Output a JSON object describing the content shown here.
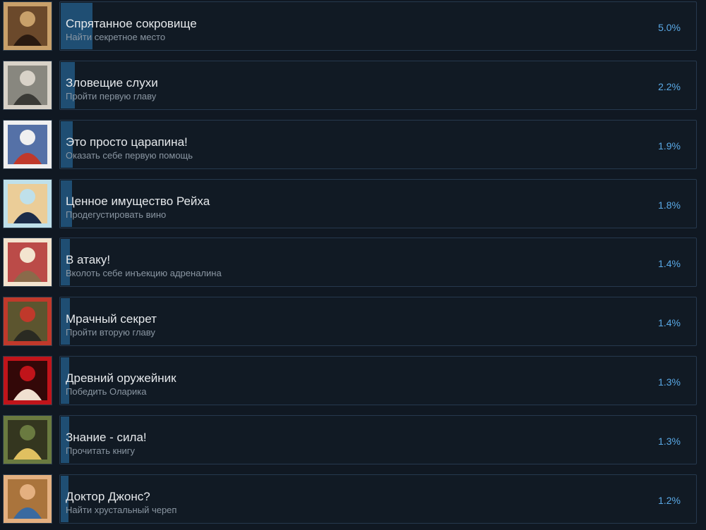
{
  "achievements": [
    {
      "title": "Спрятанное сокровище",
      "desc": "Найти секретное место",
      "percent_label": "5.0%",
      "percent": 5.0,
      "icon": "treasure-painting-icon",
      "colors": [
        "#c8a06a",
        "#5a3a20",
        "#2a1a10"
      ]
    },
    {
      "title": "Зловещие слухи",
      "desc": "Пройти первую главу",
      "percent_label": "2.2%",
      "percent": 2.2,
      "icon": "helmet-soldier-icon",
      "colors": [
        "#d8d2c8",
        "#7a7a72",
        "#3a3a36"
      ]
    },
    {
      "title": "Это просто царапина!",
      "desc": "Оказать себе первую помощь",
      "percent_label": "1.9%",
      "percent": 1.9,
      "icon": "first-aid-poster-icon",
      "colors": [
        "#f0f0f0",
        "#3a5a9a",
        "#c0392b"
      ]
    },
    {
      "title": "Ценное имущество Рейха",
      "desc": "Продегустировать вино",
      "percent_label": "1.8%",
      "percent": 1.8,
      "icon": "blindfolded-man-icon",
      "colors": [
        "#bfe0ea",
        "#f2c98a",
        "#1c2c48"
      ]
    },
    {
      "title": "В атаку!",
      "desc": "Вколоть себе инъекцию адреналина",
      "percent_label": "1.4%",
      "percent": 1.4,
      "icon": "pinup-soldier-icon",
      "colors": [
        "#f3e4cf",
        "#b03030",
        "#8a6a4a"
      ]
    },
    {
      "title": "Мрачный секрет",
      "desc": "Пройти вторую главу",
      "percent_label": "1.4%",
      "percent": 1.4,
      "icon": "soldiers-propaganda-icon",
      "colors": [
        "#c0392b",
        "#4a5a30",
        "#2a2a22"
      ]
    },
    {
      "title": "Древний оружейник",
      "desc": "Победить Оларика",
      "percent_label": "1.3%",
      "percent": 1.3,
      "icon": "red-knight-icon",
      "colors": [
        "#c0141a",
        "#1a0606",
        "#f0e0d0"
      ]
    },
    {
      "title": "Знание - сила!",
      "desc": "Прочитать книгу",
      "percent_label": "1.3%",
      "percent": 1.3,
      "icon": "reading-soldier-icon",
      "colors": [
        "#6a7a40",
        "#2a2a1a",
        "#e0c060"
      ]
    },
    {
      "title": "Доктор Джонс?",
      "desc": "Найти хрустальный череп",
      "percent_label": "1.2%",
      "percent": 1.2,
      "icon": "adventurer-face-icon",
      "colors": [
        "#e4b080",
        "#a06a30",
        "#3a6aa0"
      ]
    }
  ]
}
